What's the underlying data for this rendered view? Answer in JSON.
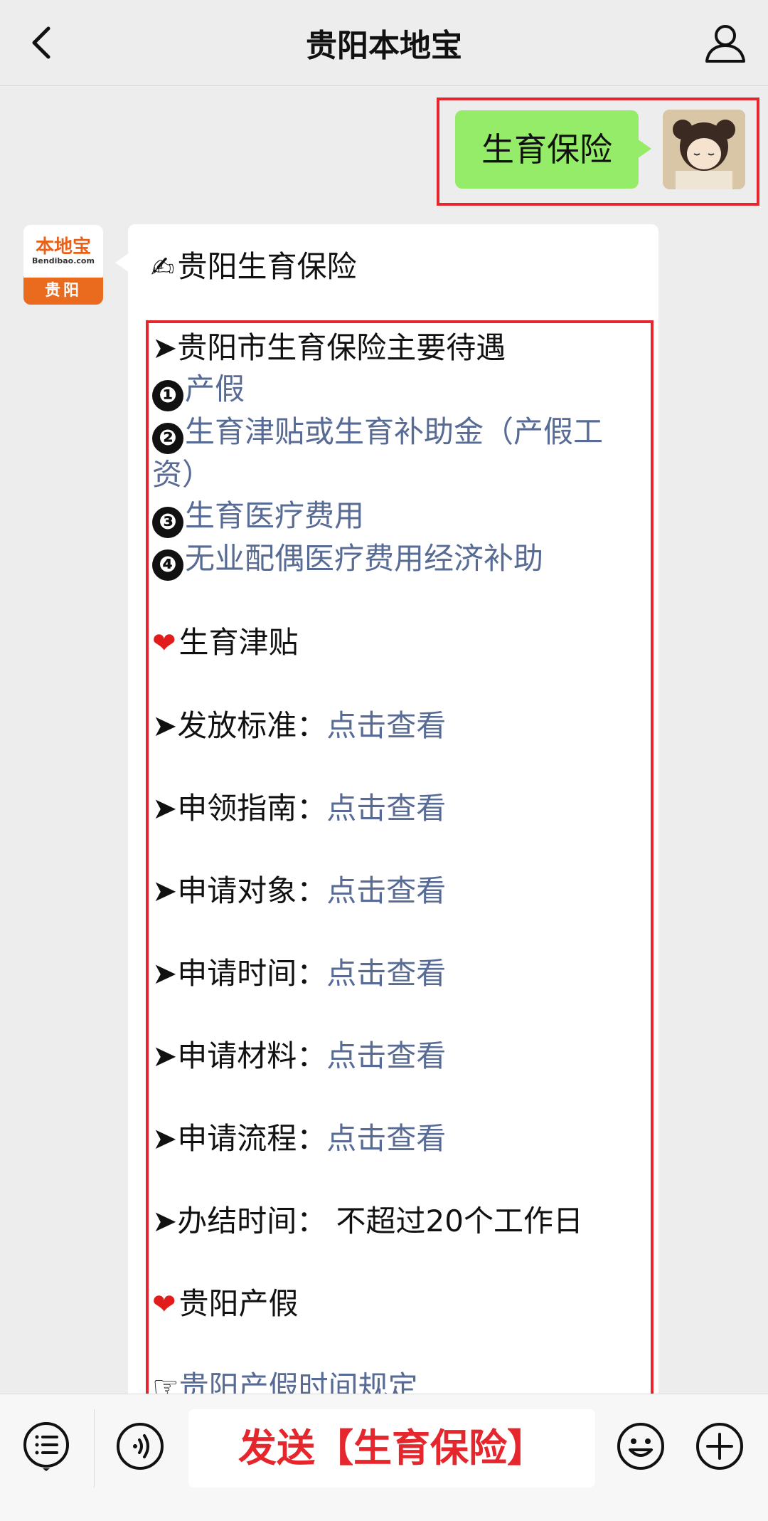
{
  "header": {
    "title": "贵阳本地宝"
  },
  "outgoing": {
    "text": "生育保险"
  },
  "bot_avatar": {
    "logo": "本地宝",
    "domain": "Bendibao.com",
    "city": "贵阳"
  },
  "incoming": {
    "title_emoji": "✍",
    "title": "贵阳生育保险",
    "lines": {
      "l1": "➤贵阳市生育保险主要待遇",
      "n1": "❶",
      "l2": "产假",
      "n2": "❷",
      "l3": "生育津贴或生育补助金（产假工资）",
      "n3": "❸",
      "l4": "生育医疗费用",
      "n4": "❹",
      "l5": "无业配偶医疗费用经济补助",
      "heart1": "❤",
      "s1": "生育津贴",
      "r1_label": "➤发放标准：",
      "r1_link": "点击查看",
      "r2_label": "➤申领指南：",
      "r2_link": "点击查看",
      "r3_label": "➤申请对象：",
      "r3_link": "点击查看",
      "r4_label": "➤申请时间：",
      "r4_link": "点击查看",
      "r5_label": "➤申请材料：",
      "r5_link": "点击查看",
      "r6_label": "➤申请流程：",
      "r6_link": "点击查看",
      "r7": "➤办结时间： 不超过20个工作日",
      "heart2": "❤",
      "s2": "贵阳产假",
      "hand": "☞",
      "last_link": "贵阳产假时间规定"
    }
  },
  "input": {
    "text": "发送【生育保险】"
  },
  "colors": {
    "link": "#576b95",
    "highlight_red": "#e5262c",
    "bubble_green": "#95ec69"
  }
}
